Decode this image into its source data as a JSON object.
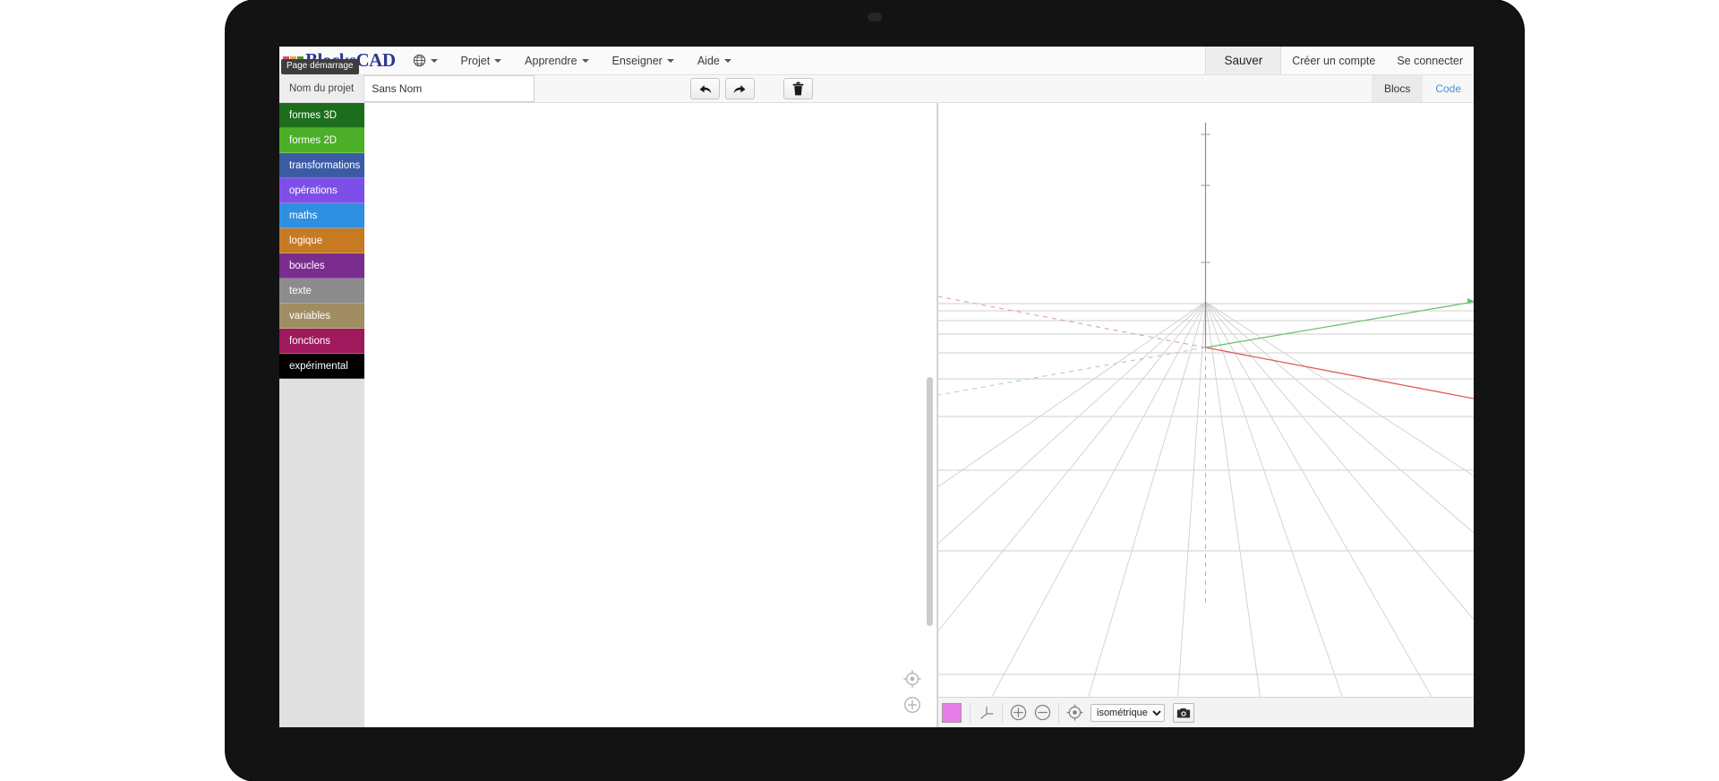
{
  "app": {
    "title": "BlocksCAD",
    "logo_text": "BlocksCAD",
    "logo_block_colors": [
      "#d94a6a",
      "#e8a33d",
      "#4f8f3f",
      "#2b3990"
    ]
  },
  "tooltip": {
    "startup_page": "Page démarrage"
  },
  "topnav": {
    "language_icon": "globe-icon",
    "menus": [
      {
        "label": "Projet",
        "has_caret": true
      },
      {
        "label": "Apprendre",
        "has_caret": true
      },
      {
        "label": "Enseigner",
        "has_caret": true
      },
      {
        "label": "Aide",
        "has_caret": true
      }
    ],
    "save_label": "Sauver",
    "signup_label": "Créer un compte",
    "login_label": "Se connecter"
  },
  "toolbar": {
    "project_name_label": "Nom du projet",
    "project_name_value": "Sans Nom",
    "project_name_placeholder": "Sans Nom",
    "undo_icon": "undo-arrow-icon",
    "redo_icon": "redo-arrow-icon",
    "trash_icon": "trash-icon",
    "tab_blocks": "Blocs",
    "tab_code": "Code"
  },
  "toolbox": {
    "categories": [
      {
        "label": "formes 3D",
        "color": "#1c6e1c"
      },
      {
        "label": "formes 2D",
        "color": "#4caf28"
      },
      {
        "label": "transformations",
        "color": "#3b5ba5"
      },
      {
        "label": "opérations",
        "color": "#7e4fe8"
      },
      {
        "label": "maths",
        "color": "#2f8fe0"
      },
      {
        "label": "logique",
        "color": "#c77a22"
      },
      {
        "label": "boucles",
        "color": "#7a2d8f"
      },
      {
        "label": "texte",
        "color": "#8c8c8c"
      },
      {
        "label": "variables",
        "color": "#a08d63"
      },
      {
        "label": "fonctions",
        "color": "#9e1a5c"
      },
      {
        "label": "expérimental",
        "color": "#000000"
      }
    ]
  },
  "workspace": {
    "zoom_center_icon": "zoom-center-icon",
    "zoom_in_icon": "zoom-in-icon",
    "scrollbar": "vertical-scrollbar"
  },
  "viewport": {
    "color_swatch_hex": "#e87ee8",
    "axes_icon": "axes-icon",
    "zoom_in_icon": "zoom-in-icon",
    "zoom_out_icon": "zoom-out-icon",
    "recenter_icon": "recenter-target-icon",
    "view_selected": "isométrique",
    "view_options": [
      "isométrique"
    ],
    "screenshot_icon": "camera-icon",
    "axis_colors": {
      "x": "#e05a5a",
      "y": "#6bbf6b",
      "z": "#999999"
    },
    "grid_color": "#c9c9c9"
  }
}
